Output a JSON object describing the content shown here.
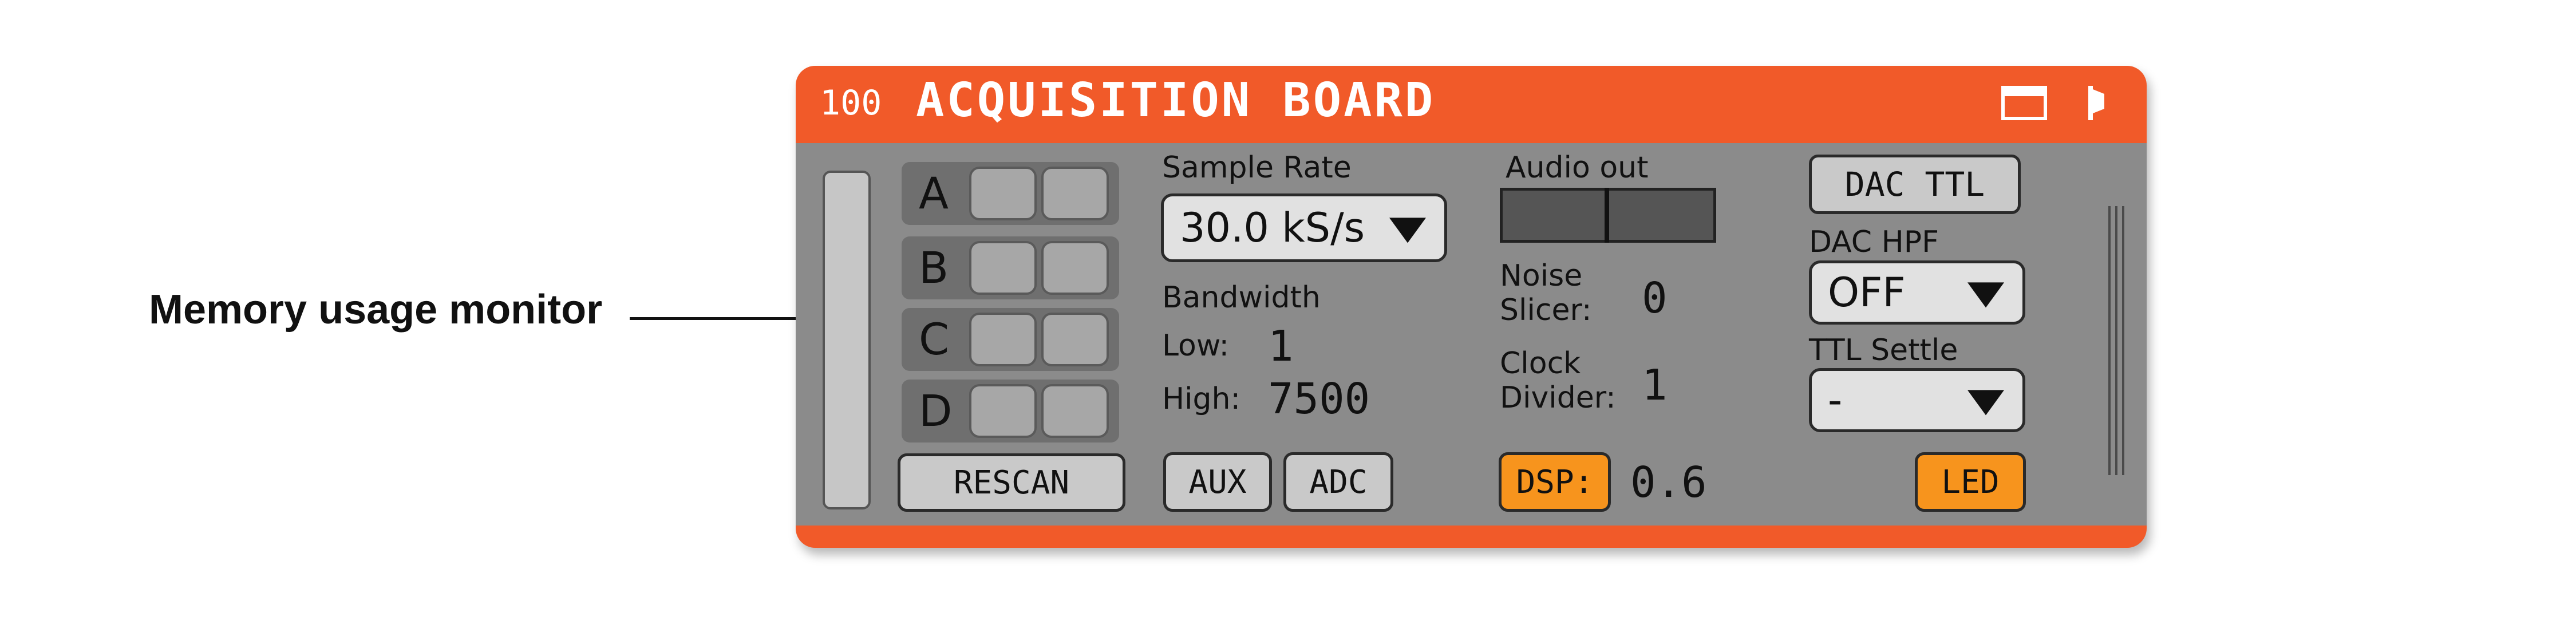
{
  "callout": {
    "label": "Memory usage monitor"
  },
  "header": {
    "node_id": "100",
    "title": "ACQUISITION BOARD",
    "accent_color": "#f15a29",
    "icons": [
      "window-icon",
      "pin-icon"
    ]
  },
  "headstages": {
    "ports": [
      "A",
      "B",
      "C",
      "D"
    ],
    "rescan_label": "RESCAN"
  },
  "sample_rate": {
    "label": "Sample Rate",
    "value": "30.0 kS/s"
  },
  "bandwidth": {
    "label": "Bandwidth",
    "low_label": "Low:",
    "low_value": "1",
    "high_label": "High:",
    "high_value": "7500"
  },
  "aux_label": "AUX",
  "adc_label": "ADC",
  "audio": {
    "label": "Audio out"
  },
  "noise_slicer": {
    "label_line1": "Noise",
    "label_line2": "Slicer:",
    "value": "0"
  },
  "clock_divider": {
    "label_line1": "Clock",
    "label_line2": "Divider:",
    "value": "1"
  },
  "dsp": {
    "label": "DSP:",
    "value": "0.6"
  },
  "dac_ttl_label": "DAC TTL",
  "dac_hpf": {
    "label": "DAC HPF",
    "value": "OFF"
  },
  "ttl_settle": {
    "label": "TTL Settle",
    "value": "-"
  },
  "led_label": "LED"
}
